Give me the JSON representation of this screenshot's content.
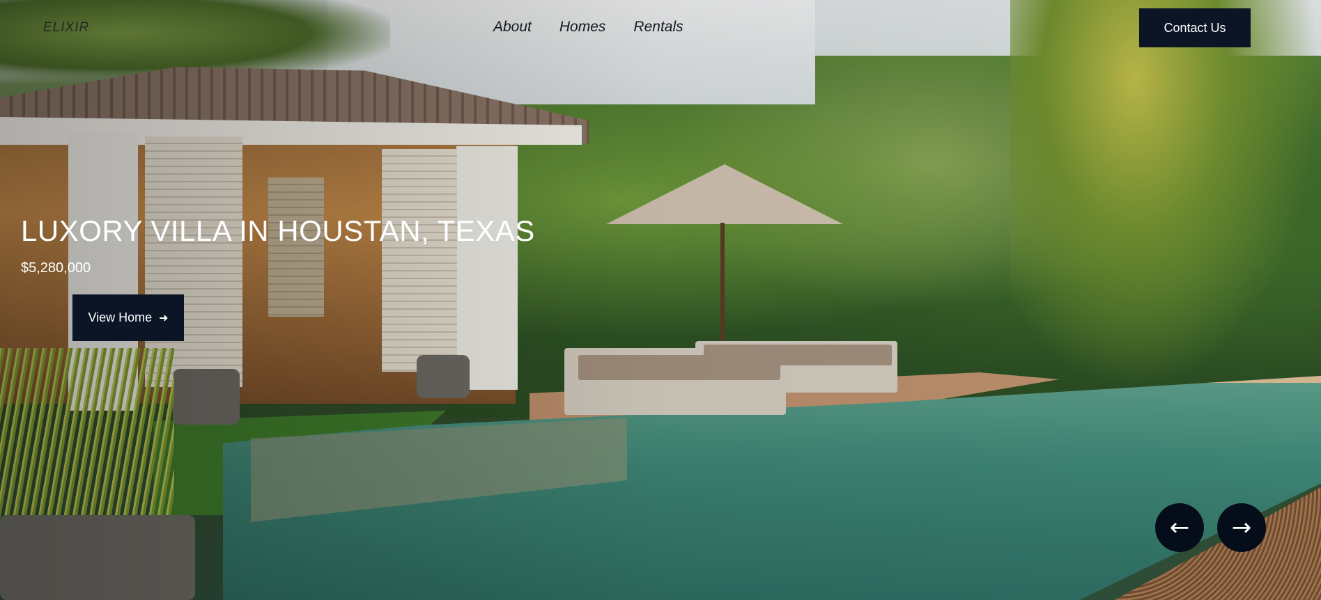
{
  "nav": {
    "logo": "ELIXIR",
    "links": [
      "About",
      "Homes",
      "Rentals"
    ],
    "contact_label": "Contact Us"
  },
  "hero": {
    "title": "LUXORY VILLA IN HOUSTAN, TEXAS",
    "price": "$5,280,000",
    "cta_label": "View Home",
    "cta_icon": "arrow-right-icon"
  },
  "carousel": {
    "prev_icon": "arrow-left-icon",
    "next_icon": "arrow-right-icon"
  },
  "colors": {
    "button_bg": "#0b1526",
    "text_light": "#ffffff",
    "nav_text": "#15171a"
  }
}
